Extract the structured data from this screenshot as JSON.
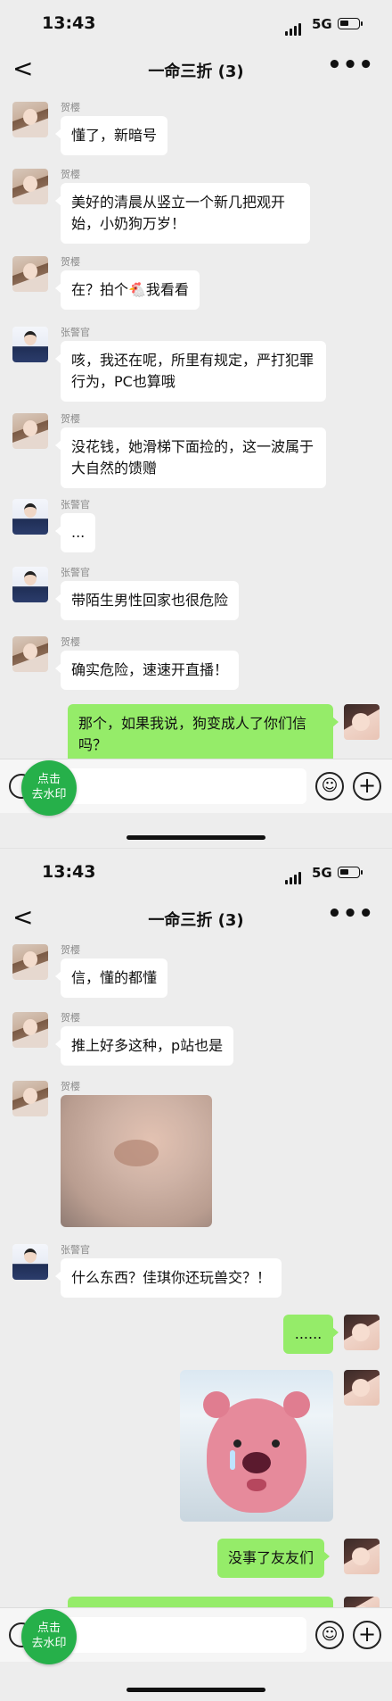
{
  "status": {
    "time": "13:43",
    "network": "5G"
  },
  "chat": {
    "title": "一命三折 (3)",
    "back": "<",
    "more": "•••"
  },
  "senders": {
    "he": "贺樱",
    "zhang": "张警官"
  },
  "screen1": {
    "messages": [
      {
        "text": "懂了，新暗号"
      },
      {
        "text": "美好的清晨从竖立一个新几把观开始，小奶狗万岁！"
      },
      {
        "text": "在？拍个🐔我看看"
      },
      {
        "text": "咳，我还在呢，所里有规定，严打犯罪行为，PC也算哦"
      },
      {
        "text": "没花钱，她滑梯下面捡的，这一波属于大自然的馈赠"
      },
      {
        "text": "..."
      },
      {
        "text": "带陌生男性回家也很危险"
      },
      {
        "text": "确实危险，速速开直播！"
      },
      {
        "text": "那个，如果我说，狗变成人了你们信吗？"
      }
    ]
  },
  "screen2": {
    "messages": [
      {
        "text": "信，懂的都懂"
      },
      {
        "text": "推上好多这种，p站也是"
      },
      {
        "text": "什么东西？佳琪你还玩兽交？！"
      },
      {
        "text": "......"
      },
      {
        "text": "没事了友友们"
      }
    ]
  },
  "inputbar": {
    "emoji": "☺",
    "plus": "+"
  },
  "watermark_badge": {
    "line1": "点击",
    "line2": "去水印"
  },
  "colors": {
    "background": "#ededed",
    "self_bubble": "#95ec69",
    "other_bubble": "#ffffff",
    "badge": "#26b04a"
  }
}
